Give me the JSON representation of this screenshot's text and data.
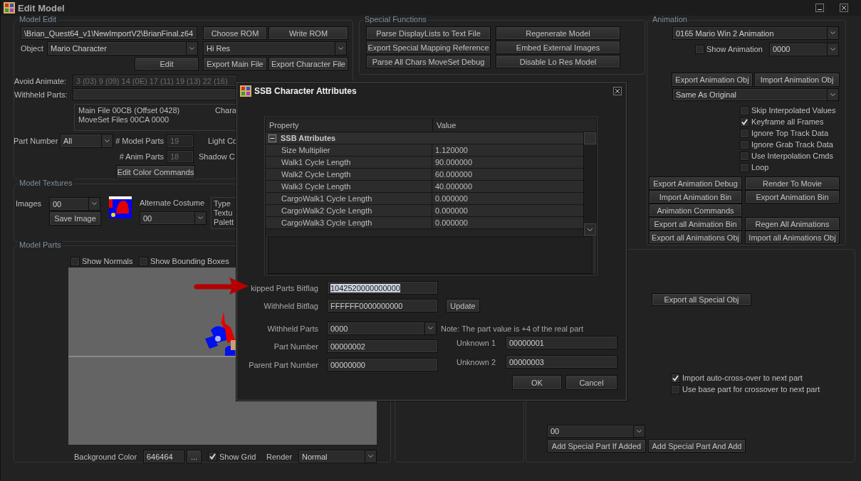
{
  "window": {
    "title": "Edit Model"
  },
  "model_edit": {
    "title": "Model Edit",
    "rom_path": "\\Brian_Quest64_v1\\NewImportV2\\BrianFinal.z64",
    "choose_rom": "Choose ROM",
    "write_rom": "Write ROM",
    "object_label": "Object",
    "object": "Mario Character",
    "resolution": "Hi Res",
    "edit": "Edit",
    "export_main_file": "Export Main File",
    "export_character_file": "Export Character File",
    "avoid_animate_label": "Avoid Animate:",
    "avoid_animate": {
      "value": "3 (03) 9 (09) 14 (0E) 17 (11) 19 (13) 22 (16)",
      "disabled": true
    },
    "withheld_parts_label": "Withheld Parts:",
    "file_info": [
      "Main File 00CB (Offset 0428)",
      "MoveSet Files 00CA 0000"
    ],
    "file_info_column_2": "Chara",
    "part_number_label": "Part Number",
    "part_number": "All",
    "model_parts_label": "# Model Parts",
    "model_parts": {
      "value": "19",
      "disabled": true
    },
    "light_label": "Light Co",
    "anim_parts_label": "# Anim Parts",
    "anim_parts": {
      "value": "18",
      "disabled": true
    },
    "shadow_label": "Shadow C",
    "edit_color_commands": "Edit Color Commands"
  },
  "model_textures": {
    "title": "Model Textures",
    "images_label": "Images",
    "image": "00",
    "save_image": "Save Image",
    "alternate_costume_label": "Alternate Costume",
    "alternate_costume": "00",
    "info_lines": [
      "Type",
      "Textu",
      "Palett"
    ]
  },
  "model_parts": {
    "title": "Model Parts",
    "options": [
      {
        "label": "Show Normals",
        "checked": false
      },
      {
        "label": "Show Bounding Boxes",
        "checked": false
      }
    ],
    "background_color_label": "Background Color",
    "background_color": "646464",
    "pick_color": "...",
    "show_grid": {
      "label": "Show Grid",
      "checked": true
    },
    "render_label": "Render",
    "render": "Normal"
  },
  "special_functions": {
    "title": "Special Functions",
    "buttons": [
      "Parse DisplayLists to Text File",
      "Regenerate Model",
      "Export Special Mapping Reference",
      "Embed External Images",
      "Parse All Chars MoveSet Debug",
      "Disable Lo Res Model"
    ]
  },
  "animation": {
    "title": "Animation",
    "animation": "0165 Mario Win 2 Animation",
    "show_animation": {
      "label": "Show Animation",
      "checked": false
    },
    "frame": "0000",
    "export_obj": "Export Animation Obj",
    "import_obj": "Import Animation Obj",
    "mode": "Same As Original",
    "options": [
      {
        "label": "Skip Interpolated Values",
        "checked": false
      },
      {
        "label": "Keyframe all Frames",
        "checked": true
      },
      {
        "label": "Ignore Top Track Data",
        "checked": false
      },
      {
        "label": "Ignore Grab Track Data",
        "checked": false
      },
      {
        "label": "Use Interpolation Cmds",
        "checked": false
      },
      {
        "label": "Loop",
        "checked": false
      }
    ],
    "button_rows": [
      [
        "Export Animation Debug",
        "Render To Movie"
      ],
      [
        "Import Animation Bin",
        "Export Animation Bin"
      ],
      [
        "Animation Commands"
      ],
      [
        "Export all Animation Bin",
        "Regen All Animations"
      ],
      [
        "Export all Animations Obj",
        "Import all Animations Obj"
      ]
    ]
  },
  "special_parts": {
    "export_all": "Export all Special Obj",
    "options": [
      {
        "label": "Import auto-cross-over to next part",
        "checked": true
      },
      {
        "label": "Use base part for crossover to next part",
        "checked": false
      }
    ],
    "part": "00",
    "add_if_added": "Add Special Part If Added",
    "add_and_add": "Add Special Part And Add"
  },
  "dialog": {
    "title": "SSB Character Attributes",
    "grid": {
      "columns": [
        "Property",
        "Value"
      ],
      "category": {
        "label": "SSB Attributes",
        "expanded": true
      },
      "rows": [
        {
          "property": "Size Multiplier",
          "value": "1.120000"
        },
        {
          "property": "Walk1 Cycle Length",
          "value": "90.000000"
        },
        {
          "property": "Walk2 Cycle Length",
          "value": "60.000000"
        },
        {
          "property": "Walk3 Cycle Length",
          "value": "40.000000"
        },
        {
          "property": "CargoWalk1 Cycle Length",
          "value": "0.000000"
        },
        {
          "property": "CargoWalk2 Cycle Length",
          "value": "0.000000"
        },
        {
          "property": "CargoWalk3 Cycle Length",
          "value": "0.000000"
        }
      ]
    },
    "skipped_label": "kipped Parts Bitflag",
    "skipped": {
      "value": "1042520000000000",
      "selected": true
    },
    "withheld_bitflag_label": "Withheld Bitflag",
    "withheld_bitflag": "FFFFFF0000000000",
    "update": "Update",
    "withheld_parts_label": "Withheld Parts",
    "withheld_parts": "0000",
    "note": "Note: The part value is +4 of the real part",
    "part_number_label": "Part Number",
    "part_number": "00000002",
    "parent_label": "Parent Part Number",
    "parent": "00000000",
    "unknown_1_label": "Unknown 1",
    "unknown_1": "00000001",
    "unknown_2_label": "Unknown 2",
    "unknown_2": "00000003",
    "ok": "OK",
    "cancel": "Cancel"
  }
}
